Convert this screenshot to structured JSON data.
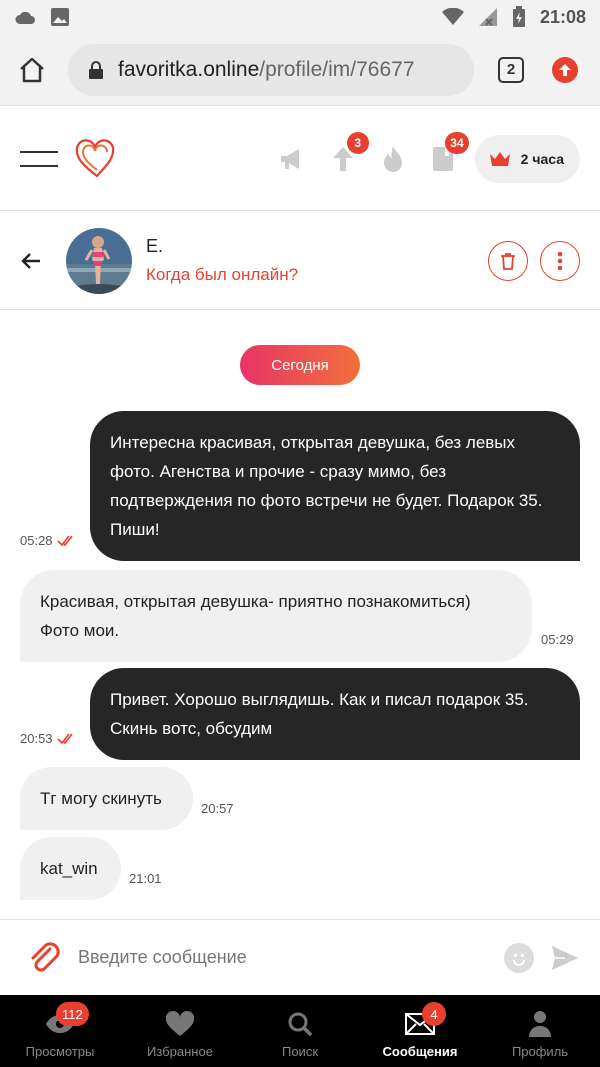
{
  "status_bar": {
    "time": "21:08"
  },
  "browser": {
    "url_domain": "favoritka.online",
    "url_path": "/profile/im/76677",
    "tab_count": "2"
  },
  "header": {
    "badges": {
      "boost": "3",
      "guests": "34"
    },
    "premium_label": "2 часа"
  },
  "chat": {
    "peer_name": "Е.",
    "peer_status": "Когда был онлайн?",
    "day_label": "Сегодня",
    "messages": [
      {
        "dir": "out",
        "text": "Интересна красивая, открытая девушка, без левых фото. Агенства и прочие - сразу мимо, без подтверждения по фото встречи не будет. Подарок 35. Пиши!",
        "time": "05:28",
        "read": true
      },
      {
        "dir": "in",
        "text": "Красивая, открытая девушка- приятно познакомиться) Фото мои.",
        "time": "05:29"
      },
      {
        "dir": "out",
        "text": "Привет. Хорошо выглядишь. Как и писал подарок 35. Скинь вотс, обсудим",
        "time": "20:53",
        "read": true
      },
      {
        "dir": "in",
        "text": "Тг могу скинуть",
        "time": "20:57"
      },
      {
        "dir": "in",
        "text": "kat_win",
        "time": "21:01"
      }
    ]
  },
  "composer": {
    "placeholder": "Введите сообщение"
  },
  "nav": {
    "items": [
      {
        "label": "Просмотры",
        "badge": "112"
      },
      {
        "label": "Избранное"
      },
      {
        "label": "Поиск"
      },
      {
        "label": "Сообщения",
        "badge": "4"
      },
      {
        "label": "Профиль"
      }
    ]
  },
  "colors": {
    "accent": "#e8402f",
    "bubble_out": "#262626",
    "bubble_in": "#f0f0f0"
  }
}
